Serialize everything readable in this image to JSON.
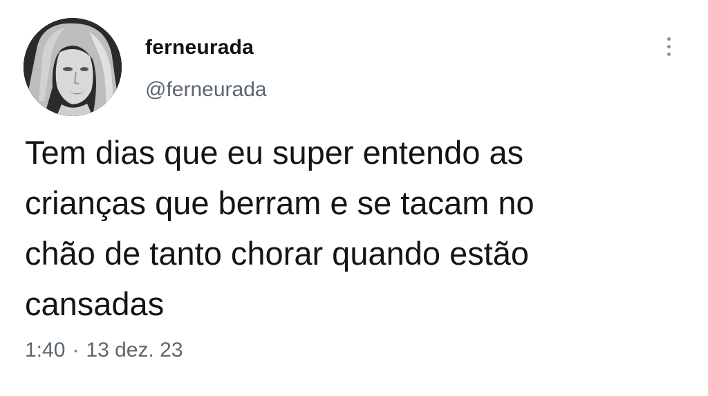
{
  "tweet": {
    "author": {
      "display_name": "ferneurada",
      "handle": "@ferneurada",
      "avatar_icon": "profile-photo"
    },
    "more_icon": "more-vertical-icon",
    "text": "Tem dias que eu super entendo as\ncrianças que berram e se tacam no\nchão de tanto chorar quando estão\ncansadas",
    "time": "1:40",
    "separator": "·",
    "date": "13 dez. 23"
  },
  "colors": {
    "text": "#141414",
    "secondary": "#5c6670",
    "background": "#ffffff"
  }
}
